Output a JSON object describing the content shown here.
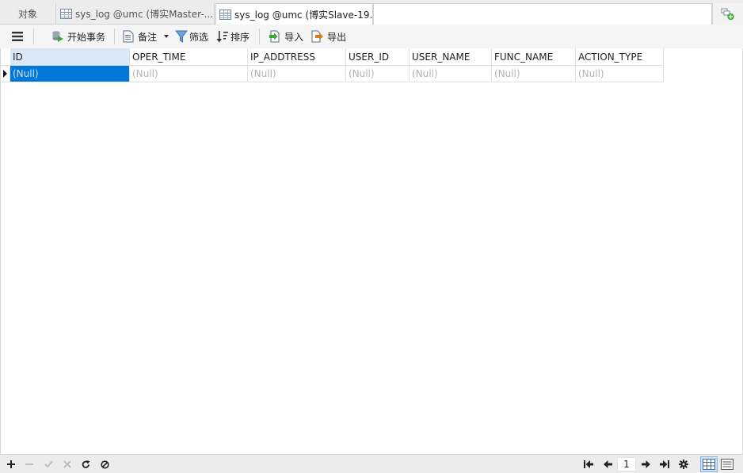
{
  "tabs": {
    "objects_label": "对象",
    "master_label": "sys_log @umc (博实Master-...",
    "slave_label": "sys_log @umc (博实Slave-19..."
  },
  "toolbar": {
    "begin_transaction": "开始事务",
    "memo": "备注",
    "filter": "筛选",
    "sort": "排序",
    "import": "导入",
    "export": "导出"
  },
  "grid": {
    "columns": [
      "ID",
      "OPER_TIME",
      "IP_ADDTRESS",
      "USER_ID",
      "USER_NAME",
      "FUNC_NAME",
      "ACTION_TYPE"
    ],
    "rows": [
      [
        "(Null)",
        "(Null)",
        "(Null)",
        "(Null)",
        "(Null)",
        "(Null)",
        "(Null)"
      ]
    ],
    "selected_column": "ID"
  },
  "status": {
    "page_number": "1"
  },
  "colors": {
    "selection": "#0078d7",
    "selected_header": "#dbe9f6",
    "null_text": "#b4b4b4"
  }
}
